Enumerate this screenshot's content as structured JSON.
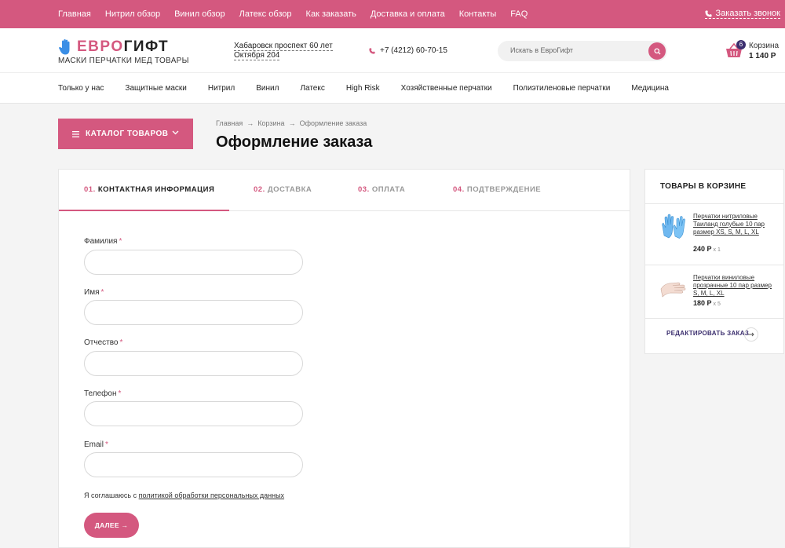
{
  "topnav": {
    "links": [
      "Главная",
      "Нитрил обзор",
      "Винил обзор",
      "Латекс обзор",
      "Как заказать",
      "Доставка и оплата",
      "Контакты",
      "FAQ"
    ],
    "callback": "Заказать звонок"
  },
  "header": {
    "logo_pink": "ЕВРО",
    "logo_dark": "ГИФТ",
    "tagline": "МАСКИ ПЕРЧАТКИ МЕД ТОВАРЫ",
    "address": "Хабаровск проспект 60 лет Октября 204",
    "phone": "+7 (4212) 60-70-15",
    "search_placeholder": "Искать в ЕвроГифт",
    "cart_count": "6",
    "cart_label": "Корзина",
    "cart_total": "1 140 Р"
  },
  "catnav": {
    "items": [
      "Только у нас",
      "Защитные маски",
      "Нитрил",
      "Винил",
      "Латекс",
      "High Risk",
      "Хозяйственные перчатки",
      "Полиэтиленовые перчатки",
      "Медицина"
    ]
  },
  "catalog_button": "КАТАЛОГ ТОВАРОВ",
  "breadcrumb": {
    "items": [
      "Главная",
      "Корзина",
      "Оформление заказа"
    ]
  },
  "page_title": "Оформление заказа",
  "steps": [
    {
      "num": "01.",
      "label": "КОНТАКТНАЯ ИНФОРМАЦИЯ",
      "active": true
    },
    {
      "num": "02.",
      "label": "ДОСТАВКА",
      "active": false
    },
    {
      "num": "03.",
      "label": "ОПЛАТА",
      "active": false
    },
    {
      "num": "04.",
      "label": "ПОДТВЕРЖДЕНИЕ",
      "active": false
    }
  ],
  "form": {
    "fields": [
      {
        "label": "Фамилия",
        "value": ""
      },
      {
        "label": "Имя",
        "value": ""
      },
      {
        "label": "Отчество",
        "value": ""
      },
      {
        "label": "Телефон",
        "value": ""
      },
      {
        "label": "Email",
        "value": ""
      }
    ],
    "required_mark": "*",
    "consent_prefix": "Я соглашаюсь с",
    "consent_link": "политикой обработки персональных данных",
    "next_button": "ДАЛЕЕ →"
  },
  "cart_panel": {
    "title": "ТОВАРЫ В КОРЗИНЕ",
    "items": [
      {
        "name": "Перчатки нитриловые Таиланд голубые 10 пар размер XS, S, M, L, XL",
        "price": "240 Р",
        "qty": "x 1",
        "icon": "blue-glove-icon"
      },
      {
        "name": "Перчатки виниловые прозрачные 10 пар размер S, M, L, XL",
        "price": "180 Р",
        "qty": "x 5",
        "icon": "clear-glove-icon"
      }
    ],
    "edit_order": "РЕДАКТИРОВАТЬ ЗАКАЗ"
  },
  "colors": {
    "accent": "#d4587f",
    "dark_accent": "#3b2e6e"
  }
}
